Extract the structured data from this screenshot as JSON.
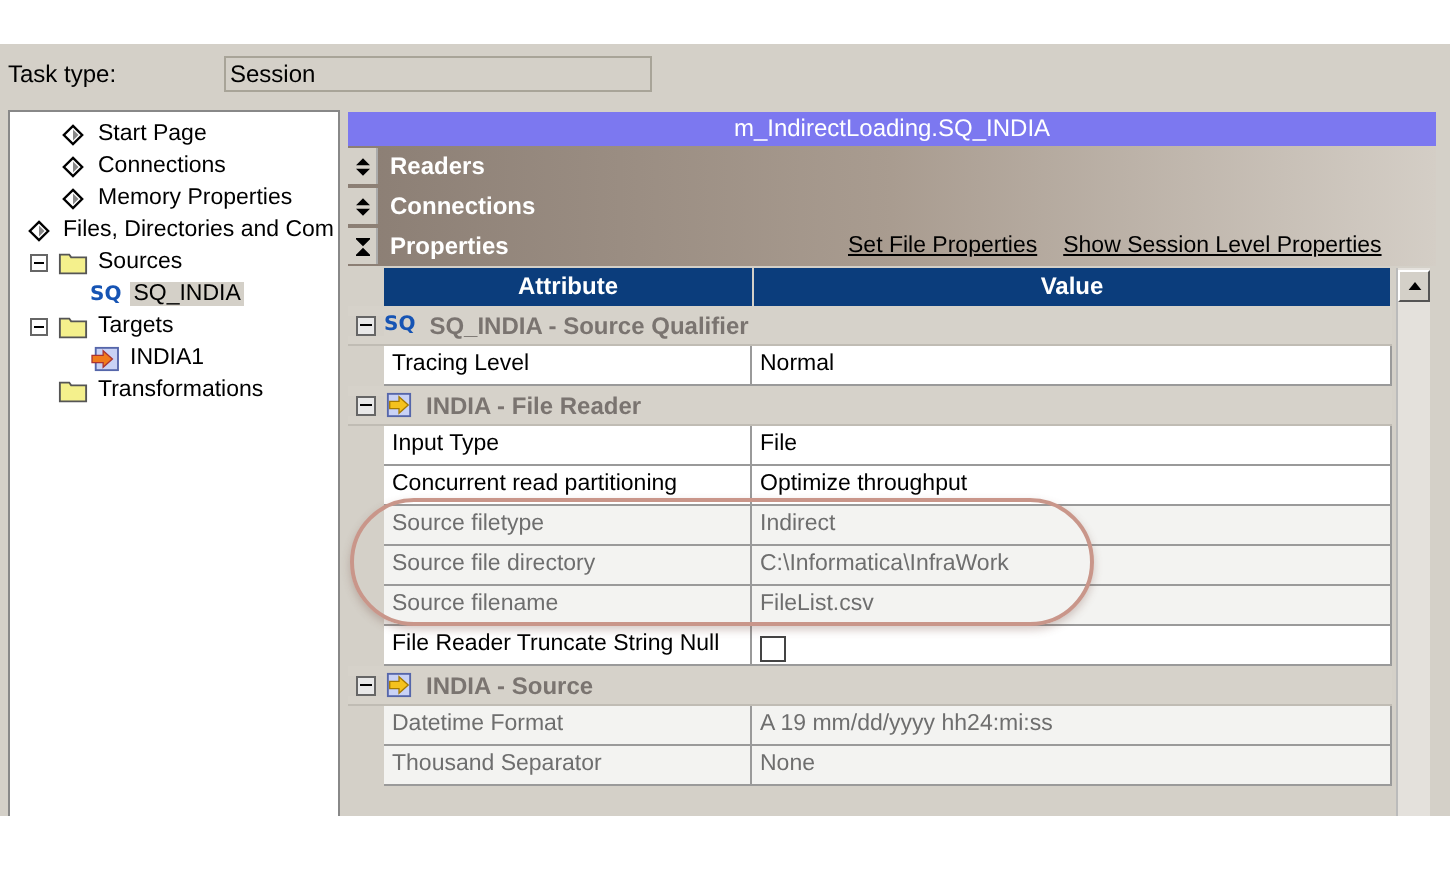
{
  "task_type": {
    "label": "Task type:",
    "value": "Session"
  },
  "tree": [
    {
      "label": "Start Page",
      "kind": "page",
      "selected": false
    },
    {
      "label": "Connections",
      "kind": "page",
      "selected": false
    },
    {
      "label": "Memory Properties",
      "kind": "page",
      "selected": false
    },
    {
      "label": "Files, Directories and Com",
      "kind": "page",
      "selected": false
    },
    {
      "label": "Sources",
      "kind": "folder",
      "selected": false,
      "expanded": true,
      "children": [
        {
          "label": "SQ_INDIA",
          "kind": "sq",
          "badge": "SQ",
          "selected": true
        }
      ]
    },
    {
      "label": "Targets",
      "kind": "folder",
      "selected": false,
      "expanded": true,
      "children": [
        {
          "label": "INDIA1",
          "kind": "target",
          "selected": false
        }
      ]
    },
    {
      "label": "Transformations",
      "kind": "folder",
      "selected": false
    }
  ],
  "panel_title": "m_IndirectLoading.SQ_INDIA",
  "sections": [
    {
      "label": "Readers",
      "expanded": false
    },
    {
      "label": "Connections",
      "expanded": false
    },
    {
      "label": "Properties",
      "expanded": true
    }
  ],
  "links": [
    "Set File Properties",
    "Show Session Level Properties"
  ],
  "table": {
    "columns": [
      "Attribute",
      "Value"
    ],
    "rows": [
      {
        "kind": "group",
        "badge": "SQ",
        "label": "SQ_INDIA - Source Qualifier",
        "expanded": true
      },
      {
        "kind": "text",
        "attribute": "Tracing Level",
        "value": "Normal",
        "disabled": false
      },
      {
        "kind": "group",
        "label": "INDIA - File Reader",
        "expanded": true
      },
      {
        "kind": "text",
        "attribute": "Input Type",
        "value": "File",
        "disabled": false
      },
      {
        "kind": "text",
        "attribute": "Concurrent read partitioning",
        "value": "Optimize throughput",
        "disabled": false
      },
      {
        "kind": "text",
        "attribute": "Source filetype",
        "value": "Indirect",
        "disabled": true
      },
      {
        "kind": "text",
        "attribute": "Source file directory",
        "value": "C:\\Informatica\\InfraWork",
        "disabled": true
      },
      {
        "kind": "text",
        "attribute": "Source filename",
        "value": "FileList.csv",
        "disabled": true
      },
      {
        "kind": "check",
        "attribute": "File Reader Truncate String Null",
        "checked": false,
        "disabled": false
      },
      {
        "kind": "group",
        "label": "INDIA - Source",
        "expanded": true
      },
      {
        "kind": "text",
        "attribute": "Datetime Format",
        "value": "A  19 mm/dd/yyyy hh24:mi:ss",
        "disabled": true
      },
      {
        "kind": "text",
        "attribute": "Thousand Separator",
        "value": "None",
        "disabled": true
      }
    ]
  }
}
